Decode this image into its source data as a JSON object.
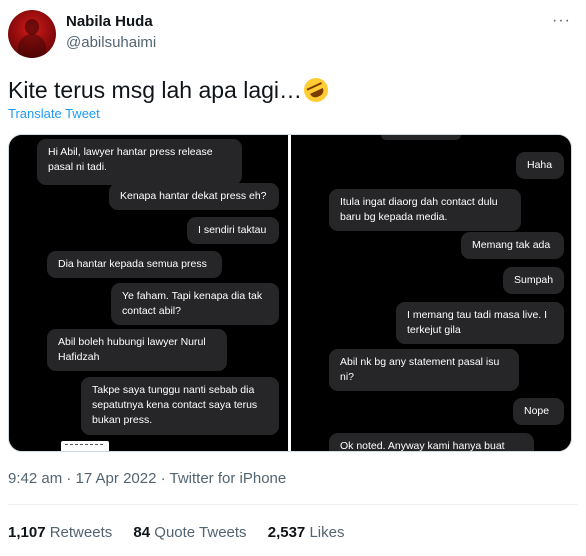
{
  "author": {
    "name": "Nabila Huda",
    "handle": "@abilsuhaimi"
  },
  "tweet": {
    "text": "Kite terus msg lah apa lagi…",
    "emoji_icon": "rolling-on-floor-laughing-emoji",
    "translate_label": "Translate Tweet"
  },
  "media": {
    "left_messages": [
      {
        "side": "incoming",
        "text": "Hi Abil, lawyer hantar press release\npasal ni tadi."
      },
      {
        "side": "outgoing",
        "text": "Kenapa hantar dekat press eh?"
      },
      {
        "side": "outgoing",
        "text": "I sendiri taktau"
      },
      {
        "side": "incoming",
        "text": "Dia hantar kepada semua press"
      },
      {
        "side": "outgoing",
        "text": "Ye faham. Tapi kenapa dia tak\ncontact abil?"
      },
      {
        "side": "incoming",
        "text": "Abil boleh hubungi lawyer Nurul\nHafidzah"
      },
      {
        "side": "outgoing",
        "text": "Takpe saya tunggu nanti sebab dia\nsepatutnya kena contact saya terus\nbukan press."
      }
    ],
    "right_messages": [
      {
        "side": "outgoing",
        "text": "Haha"
      },
      {
        "side": "incoming",
        "text": "Itula ingat diaorg dah contact dulu\nbaru bg kepada media."
      },
      {
        "side": "outgoing",
        "text": "Memang tak ada"
      },
      {
        "side": "outgoing",
        "text": "Sumpah"
      },
      {
        "side": "outgoing",
        "text": "I memang tau tadi masa live. I\nterkejut gila"
      },
      {
        "side": "incoming",
        "text": "Abil nk bg any statement pasal isu\nni?"
      },
      {
        "side": "outgoing",
        "text": "Nope"
      },
      {
        "side": "incoming",
        "text": "Ok noted. Anyway kami hanya buat"
      }
    ]
  },
  "meta": {
    "timestamp": "9:42 am · 17 Apr 2022 · ",
    "source": "Twitter for iPhone"
  },
  "stats": {
    "retweets_count": "1,107",
    "retweets_label": "Retweets",
    "quotes_count": "84",
    "quotes_label": "Quote Tweets",
    "likes_count": "2,537",
    "likes_label": "Likes"
  },
  "colors": {
    "accent": "#1d9bf0",
    "bubble": "#262628",
    "media_bg": "#000000"
  }
}
